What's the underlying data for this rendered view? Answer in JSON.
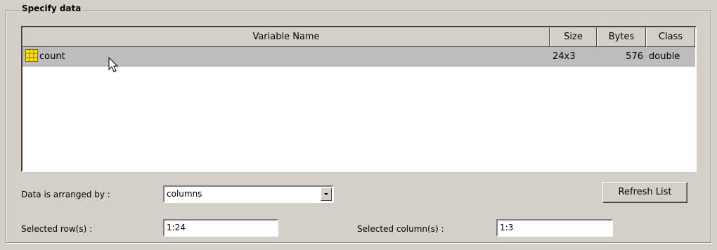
{
  "group": {
    "title": "Specify data"
  },
  "table": {
    "columns": [
      "Variable Name",
      "Size",
      "Bytes",
      "Class"
    ],
    "rows": [
      {
        "name": "count",
        "size": "24x3",
        "bytes": "576",
        "class": "double",
        "icon": "matrix-variable-icon",
        "selected": true
      }
    ]
  },
  "arrangement": {
    "label": "Data is arranged by :",
    "value": "columns"
  },
  "refresh_button": {
    "label": "Refresh List"
  },
  "rows_field": {
    "label": "Selected row(s) :",
    "value": "1:24"
  },
  "cols_field": {
    "label": "Selected column(s) :",
    "value": "1:3"
  },
  "colors": {
    "background": "#d4d0c8",
    "selected_row": "#bdbdbd",
    "icon_fill": "#ffe600"
  }
}
